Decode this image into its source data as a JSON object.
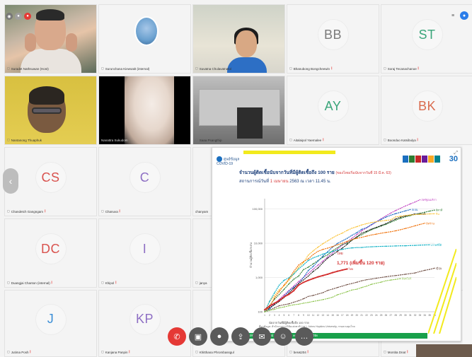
{
  "participants": [
    {
      "name": "Suradet Nathsuwan (Host)",
      "type": "video"
    },
    {
      "name": "Surunchana Kiewsatit (internal)",
      "type": "avatar-photo"
    },
    {
      "name": "Suvatna Chulavatnatol",
      "type": "video"
    },
    {
      "name": "Bhanubong Bongcheewin",
      "initials": "BB",
      "type": "initials",
      "color": "#7b7b7b"
    },
    {
      "name": "Soraj Tecanachanoe",
      "initials": "ST",
      "type": "initials",
      "color": "#3aa57a"
    },
    {
      "name": "Nantanong Thuaphuk",
      "type": "video"
    },
    {
      "name": "Nanattra Sukudom",
      "type": "video"
    },
    {
      "name": "Saaa Psangthip",
      "type": "video"
    },
    {
      "name": "Aitalaipol Yaemalee",
      "initials": "AY",
      "type": "initials",
      "color": "#3aa57a"
    },
    {
      "name": "Boonduo Katsibulya",
      "initials": "BK",
      "type": "initials",
      "color": "#d96b4e"
    },
    {
      "name": "Chandetch Gangngam",
      "initials": "CS",
      "type": "initials",
      "color": "#d9534f"
    },
    {
      "name": "Chanuva",
      "initials": "C",
      "type": "initials",
      "color": "#8e6fc4"
    },
    {
      "name": "chanyam",
      "type": "blank"
    },
    {
      "name": "Duangjai Chanton (internal)",
      "initials": "DC",
      "type": "initials",
      "color": "#d9534f"
    },
    {
      "name": "Khipol",
      "initials": "I",
      "type": "initials",
      "color": "#8e6fc4"
    },
    {
      "name": "janya",
      "type": "blank"
    },
    {
      "name": "Jutima Posh",
      "initials": "J",
      "type": "initials",
      "color": "#3b8ed6"
    },
    {
      "name": "Kanjana Panpin",
      "initials": "KP",
      "type": "initials",
      "color": "#8e6fc4"
    },
    {
      "name": "Khitthana Phrombassgul",
      "type": "blank"
    },
    {
      "name": "ben&204",
      "type": "blank"
    },
    {
      "name": "Montita Dnat",
      "type": "blank"
    }
  ],
  "slide": {
    "org": "ศูนย์ข้อมูล COVID-19",
    "anniv": "30",
    "title_main": "จำนวนผู้ติดเชื้อนับจากวันที่มีผู้ติดเชื้อถึง 100 ราย",
    "title_note": "(ของไทยเริ่มนับจากวันที่ 15 มี.ค. 63)",
    "subtitle_prefix": "สถานการณ์วันที่",
    "subtitle_date": "1 เมษายน",
    "subtitle_suffix": "2563 ณ เวลา 11.45 น.",
    "axis_note": "นับจากวันที่มีผู้ติดเชื้อถึง 100 ราย",
    "source_note": "ที่มาข้อมูล: สำนักงานการวิจัยแห่งชาติ (วช.), Johns Hopkins University, กรมควบคุมโรค",
    "annot_thai": "ไทย",
    "annot_main": "1,771 (เพิ่มขึ้น 120 ราย)",
    "footer": "ศูนย์ข้อมูลสถานการณ์ COVID-19 วช. คณะผู้ร่วมศึกษาวิจัย"
  },
  "colors": {
    "mic_off": "#e53935",
    "end_call": "#e53935",
    "toolbar_dark": "#5a5a5a",
    "slide_green": "#18a04a"
  },
  "chart_data": {
    "type": "line",
    "title": "จำนวนผู้ติดเชื้อนับจากวันที่มีผู้ติดเชื้อถึง 100 ราย",
    "xlabel": "นับจากวันที่มีผู้ติดเชื้อถึง 100 ราย",
    "ylabel": "จำนวนผู้ติดเชื้อสะสม",
    "x": [
      1,
      2,
      3,
      4,
      5,
      6,
      7,
      8,
      9,
      10,
      11,
      12,
      13,
      14,
      15,
      16,
      17,
      18,
      19,
      20,
      21,
      22,
      23,
      24,
      25,
      26,
      27,
      28,
      29,
      30,
      31,
      32,
      33,
      34,
      35,
      36
    ],
    "yscale": "log",
    "series": [
      {
        "name": "สหรัฐอเมริกา",
        "color": "#c040c0",
        "values": [
          100,
          130,
          170,
          230,
          310,
          420,
          560,
          760,
          1000,
          1300,
          1750,
          2300,
          3000,
          4000,
          5200,
          6800,
          8800,
          11000,
          14000,
          18000,
          23000,
          28000,
          34000,
          42000,
          52000,
          63000,
          76000,
          90000,
          105000,
          122000,
          140000,
          160000,
          185000
        ]
      },
      {
        "name": "อิตาลี",
        "color": "#2e7d32",
        "values": [
          100,
          150,
          230,
          320,
          450,
          650,
          890,
          1100,
          1700,
          2000,
          2500,
          3100,
          3900,
          4600,
          6000,
          7400,
          9200,
          10100,
          12400,
          15100,
          17700,
          21100,
          24700,
          28000,
          31500,
          35700,
          41000,
          47000,
          53500,
          59100,
          63900,
          69200,
          74400,
          80500,
          86500,
          92500
        ]
      },
      {
        "name": "สเปน",
        "color": "#1565c0",
        "values": [
          100,
          120,
          165,
          220,
          280,
          400,
          520,
          670,
          1000,
          1600,
          2100,
          3000,
          4200,
          5700,
          7700,
          9900,
          11700,
          13900,
          17100,
          20400,
          25400,
          28500,
          35100,
          42000,
          49500,
          57800,
          65700,
          73200,
          80100,
          87900,
          95900
        ]
      },
      {
        "name": "เยอรมนี",
        "color": "#212121",
        "values": [
          100,
          130,
          160,
          200,
          260,
          350,
          480,
          670,
          850,
          1100,
          1500,
          1900,
          2700,
          3700,
          4600,
          5800,
          7200,
          9300,
          12300,
          15300,
          19800,
          22200,
          25900,
          29000,
          32900,
          37300,
          43900,
          50900,
          57700,
          62100,
          66900,
          71800
        ]
      },
      {
        "name": "จีน",
        "color": "#fbc02d",
        "values": [
          100,
          200,
          290,
          440,
          570,
          830,
          1290,
          1980,
          2740,
          4500,
          5970,
          7700,
          9690,
          11790,
          14380,
          17200,
          19690,
          23680,
          27400,
          30500,
          34100,
          37200,
          40100,
          42600,
          44600,
          46400,
          48200,
          58800,
          61200,
          64600,
          66900,
          68400,
          69600,
          70600,
          71800,
          72400
        ]
      },
      {
        "name": "อิหร่าน",
        "color": "#ef6c00",
        "values": [
          100,
          140,
          250,
          390,
          600,
          900,
          1500,
          2300,
          2900,
          3500,
          4700,
          5800,
          6600,
          7200,
          8000,
          9000,
          10000,
          11300,
          12700,
          13900,
          14900,
          16100,
          17400,
          18400,
          19600,
          20600,
          21600,
          23000,
          24800,
          27000,
          29400,
          32300,
          35400,
          38300
        ]
      },
      {
        "name": "เกาหลีใต้",
        "color": "#00acc1",
        "values": [
          100,
          200,
          350,
          600,
          830,
          980,
          1260,
          1770,
          2340,
          3150,
          3740,
          4210,
          4810,
          5330,
          5770,
          6280,
          6590,
          7040,
          7310,
          7480,
          7510,
          7760,
          7870,
          7980,
          8090,
          8160,
          8230,
          8320,
          8410,
          8410,
          8560,
          8650,
          8800,
          8900,
          9000
        ]
      },
      {
        "name": "ญี่ปุ่น",
        "color": "#6d4c41",
        "values": [
          100,
          110,
          130,
          150,
          160,
          170,
          190,
          210,
          240,
          280,
          300,
          330,
          360,
          420,
          460,
          510,
          560,
          620,
          670,
          730,
          800,
          860,
          900,
          950,
          1000,
          1050,
          1100,
          1140,
          1190,
          1240,
          1300,
          1360,
          1490,
          1620,
          1720,
          1870
        ]
      },
      {
        "name": "ไทย",
        "color": "#d32f2f",
        "values": [
          114,
          147,
          177,
          212,
          272,
          322,
          411,
          599,
          721,
          827,
          934,
          1045,
          1136,
          1245,
          1388,
          1524,
          1651,
          1771
        ]
      },
      {
        "name": "สิงคโปร์",
        "color": "#8bc34a",
        "values": [
          100,
          110,
          117,
          130,
          138,
          150,
          160,
          166,
          178,
          187,
          200,
          212,
          226,
          243,
          266,
          313,
          345,
          385,
          432,
          455,
          509,
          558,
          631,
          683,
          732,
          802,
          844,
          879,
          926
        ]
      }
    ]
  }
}
